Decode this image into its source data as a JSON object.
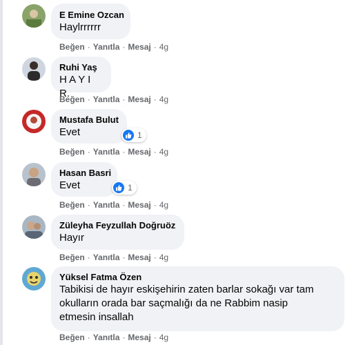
{
  "actions": {
    "like": "Beğen",
    "reply": "Yanıtla",
    "message": "Mesaj",
    "separator": "·"
  },
  "comments": [
    {
      "author": "E Emine Ozcan",
      "text": "Haylrrrrrr",
      "time": "4g"
    },
    {
      "author": "Ruhi Yaş",
      "text": "H A Y I R.",
      "time": "4g"
    },
    {
      "author": "Mustafa Bulut",
      "text": "Evet",
      "time": "4g",
      "reactions": "1"
    },
    {
      "author": "Hasan Basri",
      "text": "Evet",
      "time": "4g",
      "reactions": "1"
    },
    {
      "author": "Züleyha Feyzullah Doğruöz",
      "text": "Hayır",
      "time": "4g"
    },
    {
      "author": "Yüksel Fatma Özen",
      "text": "Tabikisi de hayır eskişehirin zaten barlar sokağı var tam okulların orada bar saçmalığı da ne Rabbim nasip etmesin insallah",
      "time": "4g"
    }
  ],
  "colors": {
    "bubble": "#f0f2f5",
    "meta_text": "#65676b",
    "like_blue": "#1877f2"
  }
}
